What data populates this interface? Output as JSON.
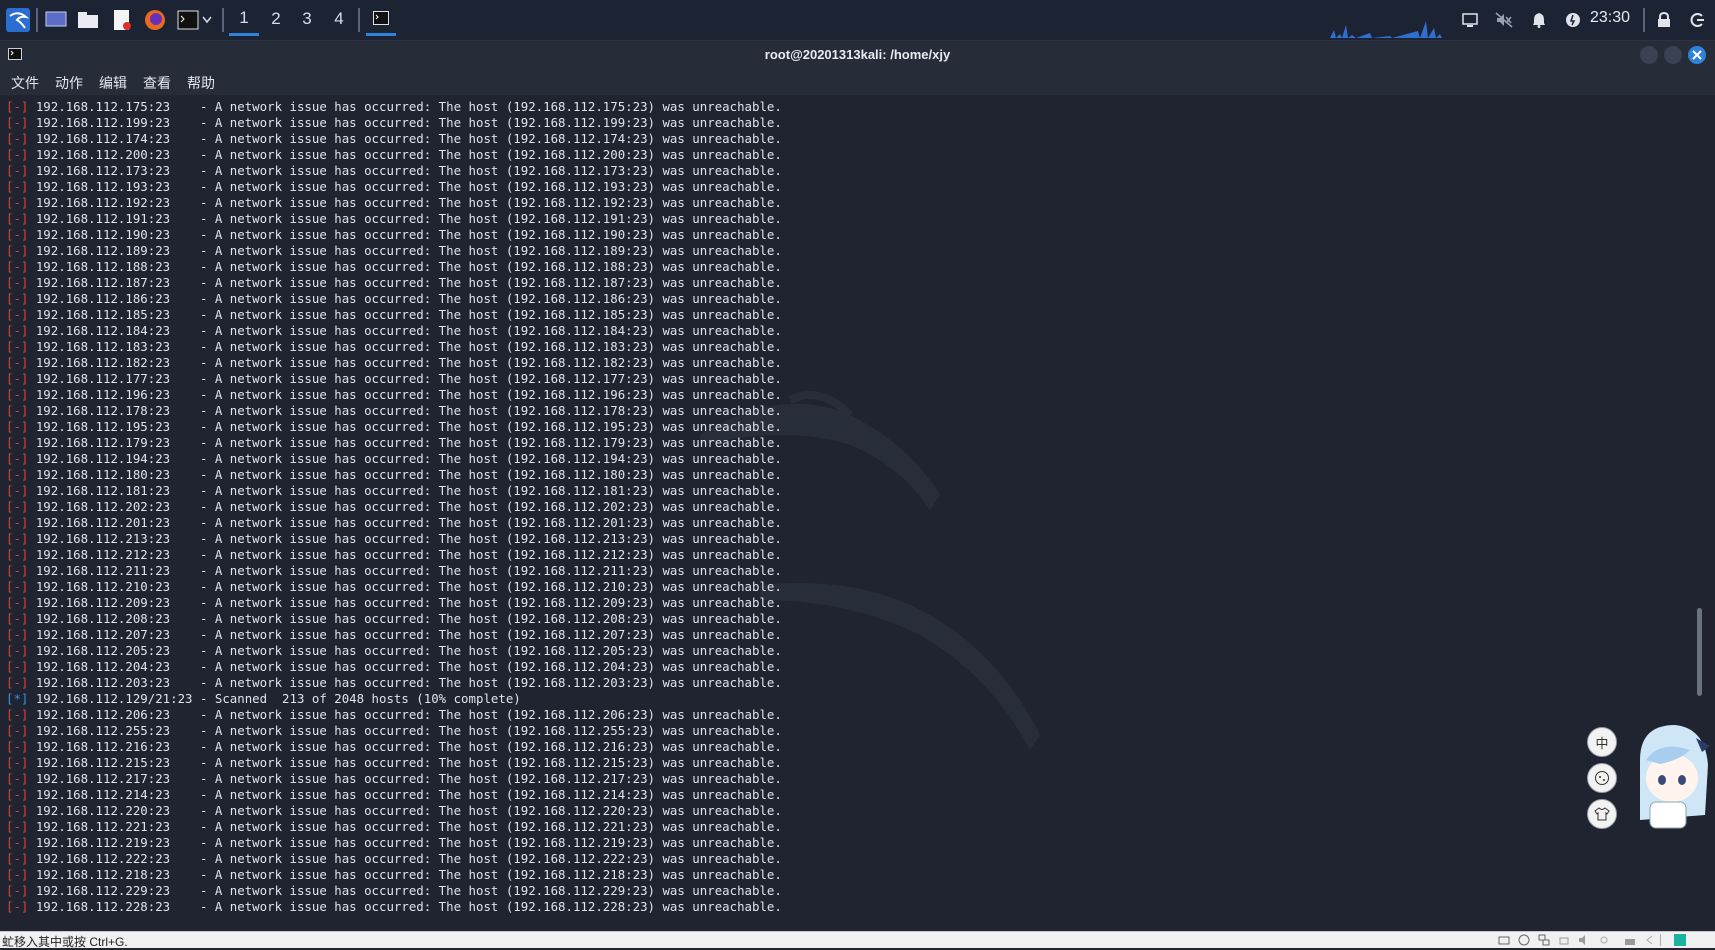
{
  "panel": {
    "workspaces": [
      "1",
      "2",
      "3",
      "4"
    ],
    "active_workspace": "1",
    "clock": "23:30"
  },
  "window": {
    "title": "root@20201313kali: /home/xjy"
  },
  "menu": [
    "文件",
    "动作",
    "编辑",
    "查看",
    "帮助"
  ],
  "terminal": {
    "lines": [
      {
        "mark": "[-]",
        "text": " 192.168.112.175:23    - A network issue has occurred: The host (192.168.112.175:23) was unreachable."
      },
      {
        "mark": "[-]",
        "text": " 192.168.112.199:23    - A network issue has occurred: The host (192.168.112.199:23) was unreachable."
      },
      {
        "mark": "[-]",
        "text": " 192.168.112.174:23    - A network issue has occurred: The host (192.168.112.174:23) was unreachable."
      },
      {
        "mark": "[-]",
        "text": " 192.168.112.200:23    - A network issue has occurred: The host (192.168.112.200:23) was unreachable."
      },
      {
        "mark": "[-]",
        "text": " 192.168.112.173:23    - A network issue has occurred: The host (192.168.112.173:23) was unreachable."
      },
      {
        "mark": "[-]",
        "text": " 192.168.112.193:23    - A network issue has occurred: The host (192.168.112.193:23) was unreachable."
      },
      {
        "mark": "[-]",
        "text": " 192.168.112.192:23    - A network issue has occurred: The host (192.168.112.192:23) was unreachable."
      },
      {
        "mark": "[-]",
        "text": " 192.168.112.191:23    - A network issue has occurred: The host (192.168.112.191:23) was unreachable."
      },
      {
        "mark": "[-]",
        "text": " 192.168.112.190:23    - A network issue has occurred: The host (192.168.112.190:23) was unreachable."
      },
      {
        "mark": "[-]",
        "text": " 192.168.112.189:23    - A network issue has occurred: The host (192.168.112.189:23) was unreachable."
      },
      {
        "mark": "[-]",
        "text": " 192.168.112.188:23    - A network issue has occurred: The host (192.168.112.188:23) was unreachable."
      },
      {
        "mark": "[-]",
        "text": " 192.168.112.187:23    - A network issue has occurred: The host (192.168.112.187:23) was unreachable."
      },
      {
        "mark": "[-]",
        "text": " 192.168.112.186:23    - A network issue has occurred: The host (192.168.112.186:23) was unreachable."
      },
      {
        "mark": "[-]",
        "text": " 192.168.112.185:23    - A network issue has occurred: The host (192.168.112.185:23) was unreachable."
      },
      {
        "mark": "[-]",
        "text": " 192.168.112.184:23    - A network issue has occurred: The host (192.168.112.184:23) was unreachable."
      },
      {
        "mark": "[-]",
        "text": " 192.168.112.183:23    - A network issue has occurred: The host (192.168.112.183:23) was unreachable."
      },
      {
        "mark": "[-]",
        "text": " 192.168.112.182:23    - A network issue has occurred: The host (192.168.112.182:23) was unreachable."
      },
      {
        "mark": "[-]",
        "text": " 192.168.112.177:23    - A network issue has occurred: The host (192.168.112.177:23) was unreachable."
      },
      {
        "mark": "[-]",
        "text": " 192.168.112.196:23    - A network issue has occurred: The host (192.168.112.196:23) was unreachable."
      },
      {
        "mark": "[-]",
        "text": " 192.168.112.178:23    - A network issue has occurred: The host (192.168.112.178:23) was unreachable."
      },
      {
        "mark": "[-]",
        "text": " 192.168.112.195:23    - A network issue has occurred: The host (192.168.112.195:23) was unreachable."
      },
      {
        "mark": "[-]",
        "text": " 192.168.112.179:23    - A network issue has occurred: The host (192.168.112.179:23) was unreachable."
      },
      {
        "mark": "[-]",
        "text": " 192.168.112.194:23    - A network issue has occurred: The host (192.168.112.194:23) was unreachable."
      },
      {
        "mark": "[-]",
        "text": " 192.168.112.180:23    - A network issue has occurred: The host (192.168.112.180:23) was unreachable."
      },
      {
        "mark": "[-]",
        "text": " 192.168.112.181:23    - A network issue has occurred: The host (192.168.112.181:23) was unreachable."
      },
      {
        "mark": "[-]",
        "text": " 192.168.112.202:23    - A network issue has occurred: The host (192.168.112.202:23) was unreachable."
      },
      {
        "mark": "[-]",
        "text": " 192.168.112.201:23    - A network issue has occurred: The host (192.168.112.201:23) was unreachable."
      },
      {
        "mark": "[-]",
        "text": " 192.168.112.213:23    - A network issue has occurred: The host (192.168.112.213:23) was unreachable."
      },
      {
        "mark": "[-]",
        "text": " 192.168.112.212:23    - A network issue has occurred: The host (192.168.112.212:23) was unreachable."
      },
      {
        "mark": "[-]",
        "text": " 192.168.112.211:23    - A network issue has occurred: The host (192.168.112.211:23) was unreachable."
      },
      {
        "mark": "[-]",
        "text": " 192.168.112.210:23    - A network issue has occurred: The host (192.168.112.210:23) was unreachable."
      },
      {
        "mark": "[-]",
        "text": " 192.168.112.209:23    - A network issue has occurred: The host (192.168.112.209:23) was unreachable."
      },
      {
        "mark": "[-]",
        "text": " 192.168.112.208:23    - A network issue has occurred: The host (192.168.112.208:23) was unreachable."
      },
      {
        "mark": "[-]",
        "text": " 192.168.112.207:23    - A network issue has occurred: The host (192.168.112.207:23) was unreachable."
      },
      {
        "mark": "[-]",
        "text": " 192.168.112.205:23    - A network issue has occurred: The host (192.168.112.205:23) was unreachable."
      },
      {
        "mark": "[-]",
        "text": " 192.168.112.204:23    - A network issue has occurred: The host (192.168.112.204:23) was unreachable."
      },
      {
        "mark": "[-]",
        "text": " 192.168.112.203:23    - A network issue has occurred: The host (192.168.112.203:23) was unreachable."
      },
      {
        "mark": "[*]",
        "text": " 192.168.112.129/21:23 - Scanned  213 of 2048 hosts (10% complete)"
      },
      {
        "mark": "[-]",
        "text": " 192.168.112.206:23    - A network issue has occurred: The host (192.168.112.206:23) was unreachable."
      },
      {
        "mark": "[-]",
        "text": " 192.168.112.255:23    - A network issue has occurred: The host (192.168.112.255:23) was unreachable."
      },
      {
        "mark": "[-]",
        "text": " 192.168.112.216:23    - A network issue has occurred: The host (192.168.112.216:23) was unreachable."
      },
      {
        "mark": "[-]",
        "text": " 192.168.112.215:23    - A network issue has occurred: The host (192.168.112.215:23) was unreachable."
      },
      {
        "mark": "[-]",
        "text": " 192.168.112.217:23    - A network issue has occurred: The host (192.168.112.217:23) was unreachable."
      },
      {
        "mark": "[-]",
        "text": " 192.168.112.214:23    - A network issue has occurred: The host (192.168.112.214:23) was unreachable."
      },
      {
        "mark": "[-]",
        "text": " 192.168.112.220:23    - A network issue has occurred: The host (192.168.112.220:23) was unreachable."
      },
      {
        "mark": "[-]",
        "text": " 192.168.112.221:23    - A network issue has occurred: The host (192.168.112.221:23) was unreachable."
      },
      {
        "mark": "[-]",
        "text": " 192.168.112.219:23    - A network issue has occurred: The host (192.168.112.219:23) was unreachable."
      },
      {
        "mark": "[-]",
        "text": " 192.168.112.222:23    - A network issue has occurred: The host (192.168.112.222:23) was unreachable."
      },
      {
        "mark": "[-]",
        "text": " 192.168.112.218:23    - A network issue has occurred: The host (192.168.112.218:23) was unreachable."
      },
      {
        "mark": "[-]",
        "text": " 192.168.112.229:23    - A network issue has occurred: The host (192.168.112.229:23) was unreachable."
      },
      {
        "mark": "[-]",
        "text": " 192.168.112.228:23    - A network issue has occurred: The host (192.168.112.228:23) was unreachable."
      }
    ]
  },
  "floating_widget": {
    "ime_button": "中"
  },
  "statusbar": {
    "text": "虻移入其中或按 Ctrl+G."
  },
  "colors": {
    "error_mark": "#e0403c",
    "info_mark": "#3d8fe6",
    "accent": "#2e82d8"
  }
}
